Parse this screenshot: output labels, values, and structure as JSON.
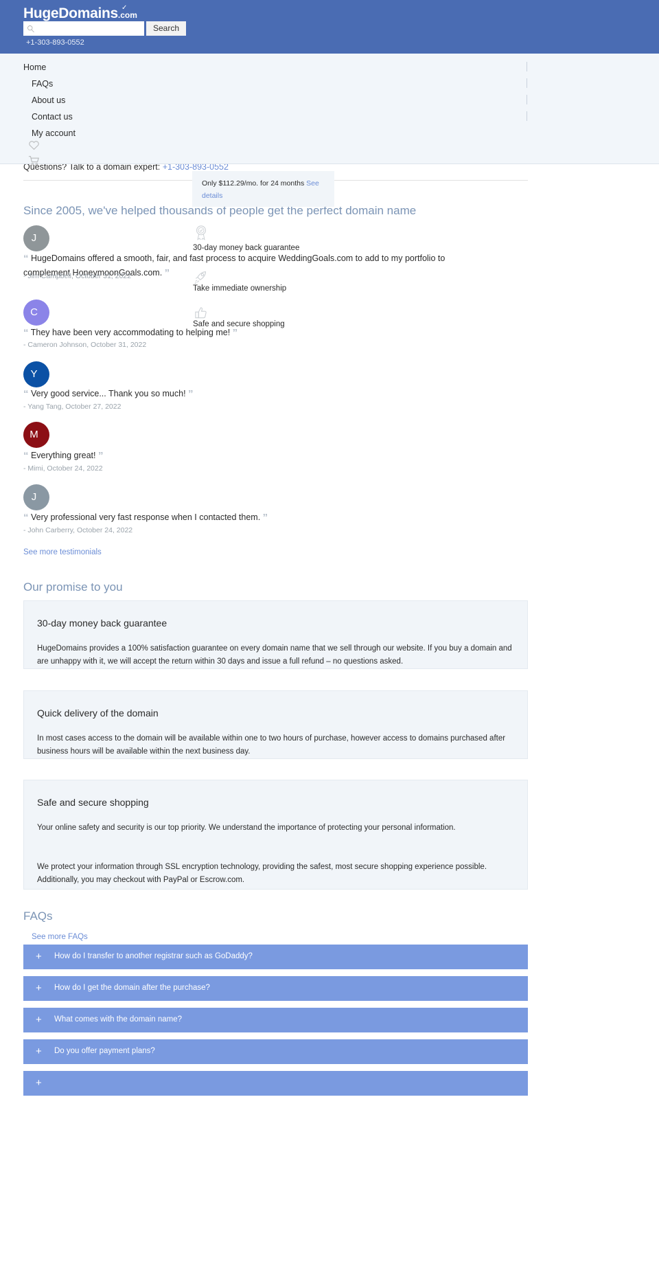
{
  "header": {
    "brand_main": "HugeDomains",
    "brand_suffix": ".com",
    "search_value": "",
    "search_placeholder": "",
    "search_button": "Search",
    "phone": "+1-303-893-0552"
  },
  "nav": {
    "items": [
      {
        "label": "Home"
      },
      {
        "label": "FAQs"
      },
      {
        "label": "About us"
      },
      {
        "label": "Contact us"
      },
      {
        "label": "My account"
      }
    ],
    "wishlist_icon": "heart-icon",
    "cart_icon": "cart-icon"
  },
  "questions_bar": {
    "text": "Questions? Talk to a domain expert:",
    "phone": "+1-303-893-0552"
  },
  "price_popup": {
    "text": "Only $112.29/mo. for 24 months",
    "link": "See details"
  },
  "testimonials_section": {
    "heading": "Since 2005, we've helped thousands of people get the perfect domain name",
    "see_more": "See more testimonials",
    "items": [
      {
        "initial": "J",
        "color": "#8f9699",
        "quote": "HugeDomains offered a smooth, fair, and fast process to acquire WeddingGoals.com to add to my portfolio to complement HoneymoonGoals.com.",
        "author": "- Jim Campbell, October 31, 2022"
      },
      {
        "initial": "C",
        "color": "#8b84e8",
        "quote": "They have been very accommodating to helping me!",
        "author": "- Cameron Johnson, October 31, 2022"
      },
      {
        "initial": "Y",
        "color": "#0b51a5",
        "quote": "Very good service... Thank you so much!",
        "author": "- Yang Tang, October 27, 2022"
      },
      {
        "initial": "M",
        "color": "#8c0f15",
        "quote": "Everything great!",
        "author": "- Mimi, October 24, 2022"
      },
      {
        "initial": "J",
        "color": "#8a98a3",
        "quote": "Very professional very fast response when I contacted them.",
        "author": "- John Carberry, October 24, 2022"
      }
    ]
  },
  "features": [
    {
      "icon": "badge-check-icon",
      "label": "30-day money back guarantee"
    },
    {
      "icon": "rocket-icon",
      "label": "Take immediate ownership"
    },
    {
      "icon": "thumbs-up-icon",
      "label": "Safe and secure shopping"
    }
  ],
  "promise_section": {
    "heading": "Our promise to you",
    "cards": [
      {
        "title": "30-day money back guarantee",
        "paragraphs": [
          "HugeDomains provides a 100% satisfaction guarantee on every domain name that we sell through our website. If you buy a domain and are unhappy with it, we will accept the return within 30 days and issue a full refund – no questions asked."
        ]
      },
      {
        "title": "Quick delivery of the domain",
        "paragraphs": [
          "In most cases access to the domain will be available within one to two hours of purchase, however access to domains purchased after business hours will be available within the next business day."
        ]
      },
      {
        "title": "Safe and secure shopping",
        "paragraphs": [
          "Your online safety and security is our top priority. We understand the importance of protecting your personal information.",
          "We protect your information through SSL encryption technology, providing the safest, most secure shopping experience possible. Additionally, you may checkout with PayPal or Escrow.com."
        ]
      }
    ]
  },
  "faq_section": {
    "heading": "FAQs",
    "see_more": "See more FAQs",
    "expand_icon": "plus-icon",
    "items": [
      {
        "question": "How do I transfer to another registrar such as GoDaddy?"
      },
      {
        "question": "How do I get the domain after the purchase?"
      },
      {
        "question": "What comes with the domain name?"
      },
      {
        "question": "Do you offer payment plans?"
      },
      {
        "question": ""
      }
    ]
  },
  "colors": {
    "brand_blue": "#4a6cb3",
    "panel_bg": "#f2f6fa",
    "link_blue": "#6b8dd6",
    "faq_bar": "#7a9ae0",
    "heading_blue": "#7b94b5"
  }
}
